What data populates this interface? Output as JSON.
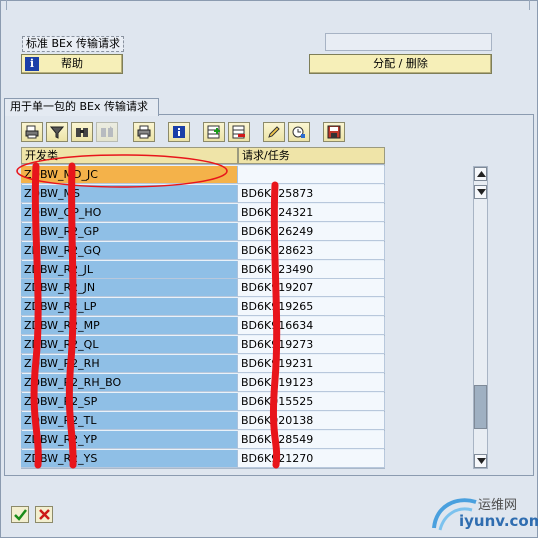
{
  "header": {
    "title_label": "标准 BEx 传输请求",
    "display_field_value": "",
    "help_button_label": "帮助",
    "assign_delete_button_label": "分配 / 删除"
  },
  "group": {
    "tab_label": "用于单一包的 BEx 传输请求"
  },
  "toolbar": {
    "buttons": [
      {
        "icon": "printer-preview-icon"
      },
      {
        "icon": "filter-icon"
      },
      {
        "icon": "find-icon"
      },
      {
        "icon": "find-next-icon"
      },
      {
        "icon": "print-icon"
      },
      {
        "icon": "info-icon"
      },
      {
        "icon": "insert-row-icon"
      },
      {
        "icon": "delete-row-icon"
      },
      {
        "icon": "edit-pencil-icon"
      },
      {
        "icon": "where-used-icon"
      },
      {
        "icon": "save-icon"
      }
    ]
  },
  "table": {
    "headers": [
      "开发类",
      "请求/任务"
    ],
    "rows": [
      {
        "dev": "ZDBW_MD_JC",
        "req": ""
      },
      {
        "dev": "ZDBW_MS",
        "req": "BD6K925873"
      },
      {
        "dev": "ZDBW_OP_HO",
        "req": "BD6K924321"
      },
      {
        "dev": "ZDBW_R2_GP",
        "req": "BD6K926249"
      },
      {
        "dev": "ZDBW_R2_GQ",
        "req": "BD6K928623"
      },
      {
        "dev": "ZDBW_R2_JL",
        "req": "BD6K923490"
      },
      {
        "dev": "ZDBW_R2_JN",
        "req": "BD6K919207"
      },
      {
        "dev": "ZDBW_R2_LP",
        "req": "BD6K919265"
      },
      {
        "dev": "ZDBW_R2_MP",
        "req": "BD6K916634"
      },
      {
        "dev": "ZDBW_R2_QL",
        "req": "BD6K919273"
      },
      {
        "dev": "ZDBW_R2_RH",
        "req": "BD6K919231"
      },
      {
        "dev": "ZDBW_R2_RH_BO",
        "req": "BD6K919123"
      },
      {
        "dev": "ZDBW_R2_SP",
        "req": "BD6K915525"
      },
      {
        "dev": "ZDBW_R2_TL",
        "req": "BD6K920138"
      },
      {
        "dev": "ZDBW_R2_YP",
        "req": "BD6K928549"
      },
      {
        "dev": "ZDBW_R2_YS",
        "req": "BD6K921270"
      }
    ],
    "selected_row": 0
  },
  "bottom": {
    "ok_icon": "checkmark-icon",
    "cancel_icon": "cross-icon"
  },
  "watermark": {
    "line1": "运维网",
    "line2": "iyunv.com"
  },
  "colors": {
    "dev_column_bg": "#8fbfe6",
    "selected_row_bg": "#f4b24a",
    "button_bg": "#f6efb8",
    "annotation_red": "#e8151b"
  }
}
